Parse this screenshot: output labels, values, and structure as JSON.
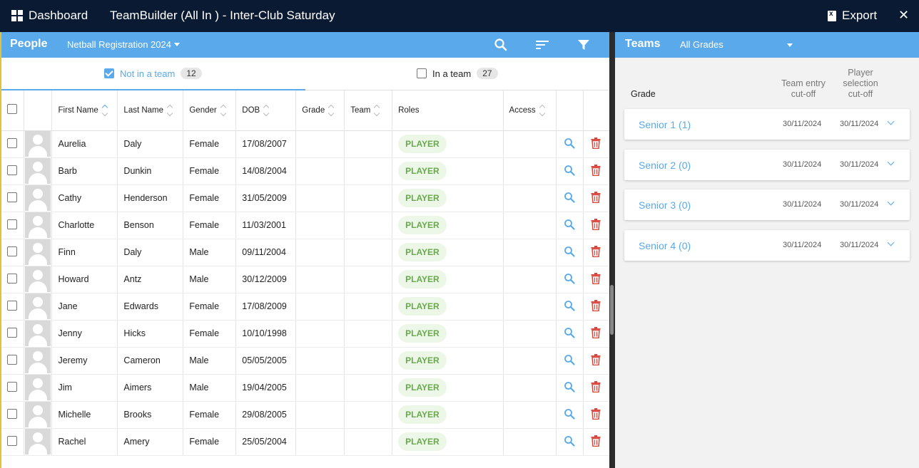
{
  "topbar": {
    "dashboard_label": "Dashboard",
    "title": "TeamBuilder (All In ) -  Inter-Club Saturday",
    "export_label": "Export",
    "close_glyph": "✕"
  },
  "people": {
    "label": "People",
    "registration": "Netball Registration 2024",
    "tabs": {
      "not_in_team_label": "Not in a team",
      "not_in_team_count": "12",
      "in_team_label": "In a team",
      "in_team_count": "27"
    },
    "columns": {
      "first_name": "First Name",
      "last_name": "Last Name",
      "gender": "Gender",
      "dob": "DOB",
      "grade": "Grade",
      "team": "Team",
      "roles": "Roles",
      "access": "Access"
    },
    "rows": [
      {
        "first": "Aurelia",
        "last": "Daly",
        "gender": "Female",
        "dob": "17/08/2007",
        "role": "PLAYER"
      },
      {
        "first": "Barb",
        "last": "Dunkin",
        "gender": "Female",
        "dob": "14/08/2004",
        "role": "PLAYER"
      },
      {
        "first": "Cathy",
        "last": "Henderson",
        "gender": "Female",
        "dob": "31/05/2009",
        "role": "PLAYER"
      },
      {
        "first": "Charlotte",
        "last": "Benson",
        "gender": "Female",
        "dob": "11/03/2001",
        "role": "PLAYER"
      },
      {
        "first": "Finn",
        "last": "Daly",
        "gender": "Male",
        "dob": "09/11/2004",
        "role": "PLAYER"
      },
      {
        "first": "Howard",
        "last": "Antz",
        "gender": "Male",
        "dob": "30/12/2009",
        "role": "PLAYER"
      },
      {
        "first": "Jane",
        "last": "Edwards",
        "gender": "Female",
        "dob": "17/08/2009",
        "role": "PLAYER"
      },
      {
        "first": "Jenny",
        "last": "Hicks",
        "gender": "Female",
        "dob": "10/10/1998",
        "role": "PLAYER"
      },
      {
        "first": "Jeremy",
        "last": "Cameron",
        "gender": "Male",
        "dob": "05/05/2005",
        "role": "PLAYER"
      },
      {
        "first": "Jim",
        "last": "Aimers",
        "gender": "Male",
        "dob": "19/04/2005",
        "role": "PLAYER"
      },
      {
        "first": "Michelle",
        "last": "Brooks",
        "gender": "Female",
        "dob": "29/08/2005",
        "role": "PLAYER"
      },
      {
        "first": "Rachel",
        "last": "Amery",
        "gender": "Female",
        "dob": "25/05/2004",
        "role": "PLAYER"
      }
    ]
  },
  "teams": {
    "label": "Teams",
    "grade_filter": "All Grades",
    "col_grade": "Grade",
    "col_entry": "Team entry cut-off",
    "col_selection": "Player selection cut-off",
    "items": [
      {
        "name": "Senior 1 (1)",
        "entry": "30/11/2024",
        "selection": "30/11/2024"
      },
      {
        "name": "Senior 2 (0)",
        "entry": "30/11/2024",
        "selection": "30/11/2024"
      },
      {
        "name": "Senior 3 (0)",
        "entry": "30/11/2024",
        "selection": "30/11/2024"
      },
      {
        "name": "Senior 4 (0)",
        "entry": "30/11/2024",
        "selection": "30/11/2024"
      }
    ]
  },
  "colors": {
    "topbar": "#0b1a33",
    "accent": "#5aa9ea",
    "player_badge": "#6aa84f",
    "delete": "#d9453a"
  }
}
